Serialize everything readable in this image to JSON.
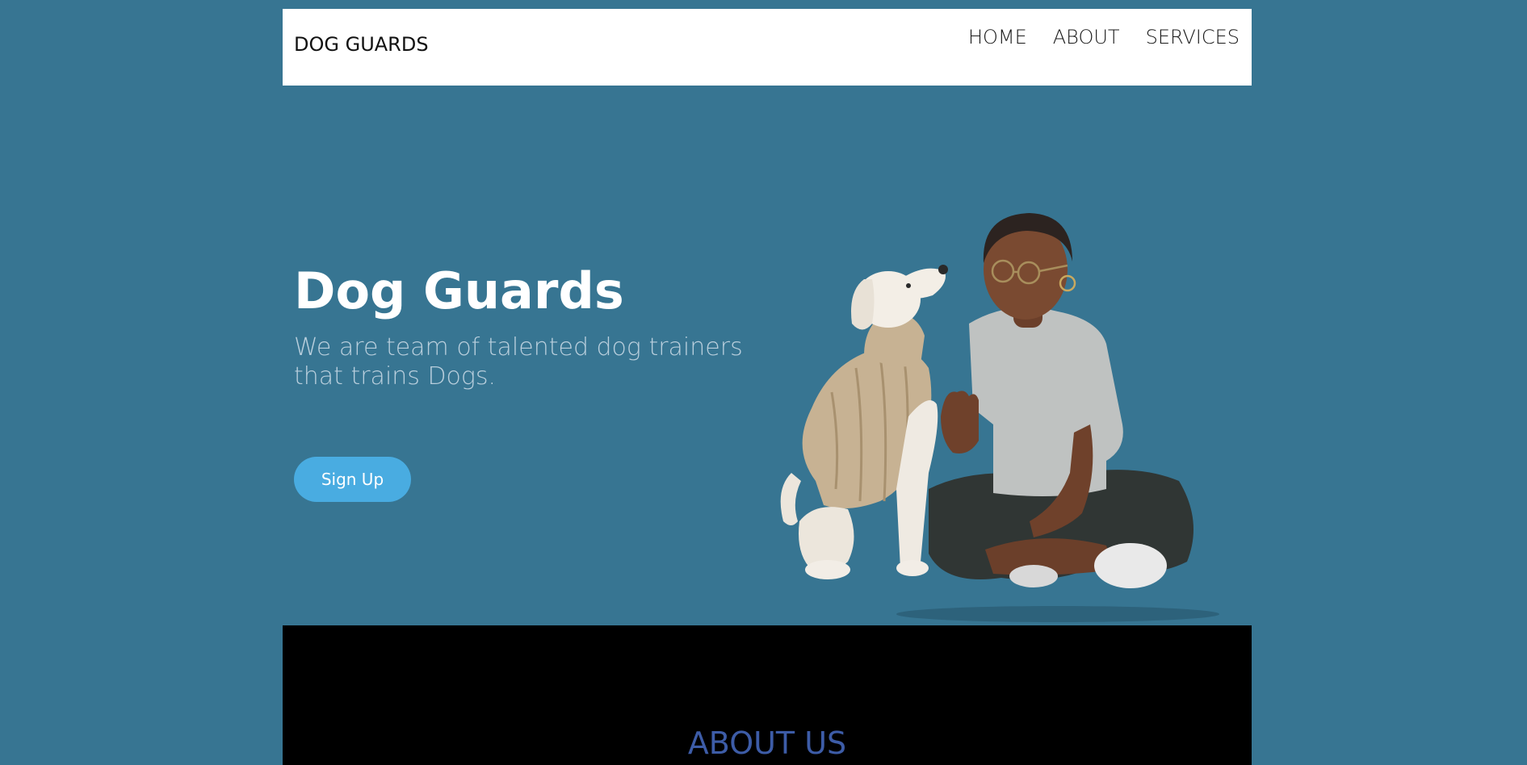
{
  "navbar": {
    "brand": "DOG GUARDS",
    "links": [
      "HOME",
      "ABOUT",
      "SERVICES"
    ]
  },
  "hero": {
    "title": "Dog Guards",
    "subtitle": "We are team of talented dog trainers that trains Dogs.",
    "signup_label": "Sign Up"
  },
  "about": {
    "title": "ABOUT US"
  },
  "colors": {
    "page_background": "#377592",
    "navbar_background": "#ffffff",
    "button": "#49ace1",
    "about_background": "#000000",
    "about_title": "#3d5ca7"
  }
}
